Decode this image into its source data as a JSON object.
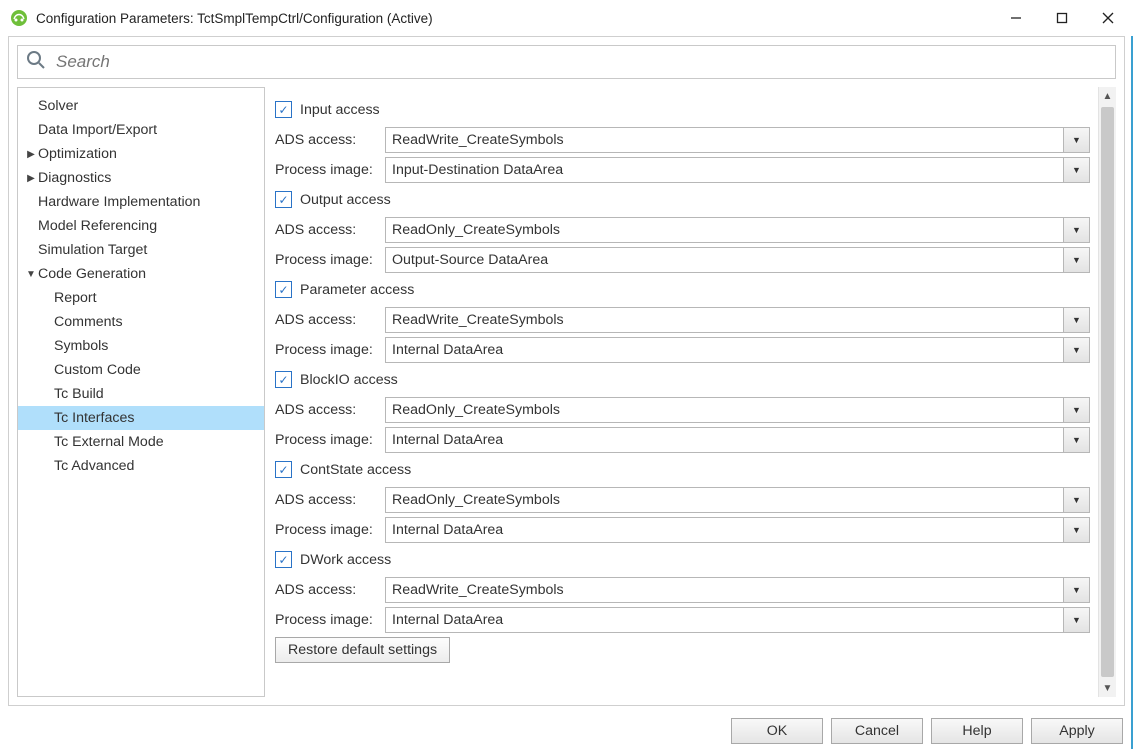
{
  "window": {
    "title": "Configuration Parameters: TctSmplTempCtrl/Configuration (Active)"
  },
  "search": {
    "placeholder": "Search"
  },
  "nav": {
    "items": [
      {
        "label": "Solver",
        "indent": 1,
        "caret": ""
      },
      {
        "label": "Data Import/Export",
        "indent": 1,
        "caret": ""
      },
      {
        "label": "Optimization",
        "indent": 1,
        "caret": "▶"
      },
      {
        "label": "Diagnostics",
        "indent": 1,
        "caret": "▶"
      },
      {
        "label": "Hardware Implementation",
        "indent": 1,
        "caret": ""
      },
      {
        "label": "Model Referencing",
        "indent": 1,
        "caret": ""
      },
      {
        "label": "Simulation Target",
        "indent": 1,
        "caret": ""
      },
      {
        "label": "Code Generation",
        "indent": 1,
        "caret": "▼"
      },
      {
        "label": "Report",
        "indent": 2,
        "caret": ""
      },
      {
        "label": "Comments",
        "indent": 2,
        "caret": ""
      },
      {
        "label": "Symbols",
        "indent": 2,
        "caret": ""
      },
      {
        "label": "Custom Code",
        "indent": 2,
        "caret": ""
      },
      {
        "label": "Tc Build",
        "indent": 2,
        "caret": ""
      },
      {
        "label": "Tc Interfaces",
        "indent": 2,
        "caret": "",
        "selected": true
      },
      {
        "label": "Tc External Mode",
        "indent": 2,
        "caret": ""
      },
      {
        "label": "Tc Advanced",
        "indent": 2,
        "caret": ""
      }
    ]
  },
  "sections": [
    {
      "check_label": "Input access",
      "ads": "ReadWrite_CreateSymbols",
      "proc": "Input-Destination DataArea"
    },
    {
      "check_label": "Output access",
      "ads": "ReadOnly_CreateSymbols",
      "proc": "Output-Source DataArea"
    },
    {
      "check_label": "Parameter access",
      "ads": "ReadWrite_CreateSymbols",
      "proc": "Internal DataArea"
    },
    {
      "check_label": "BlockIO access",
      "ads": "ReadOnly_CreateSymbols",
      "proc": "Internal DataArea"
    },
    {
      "check_label": "ContState access",
      "ads": "ReadOnly_CreateSymbols",
      "proc": "Internal DataArea"
    },
    {
      "check_label": "DWork access",
      "ads": "ReadWrite_CreateSymbols",
      "proc": "Internal DataArea"
    }
  ],
  "labels": {
    "ads": "ADS access:",
    "proc": "Process image:",
    "restore": "Restore default settings",
    "ok": "OK",
    "cancel": "Cancel",
    "help": "Help",
    "apply": "Apply"
  }
}
